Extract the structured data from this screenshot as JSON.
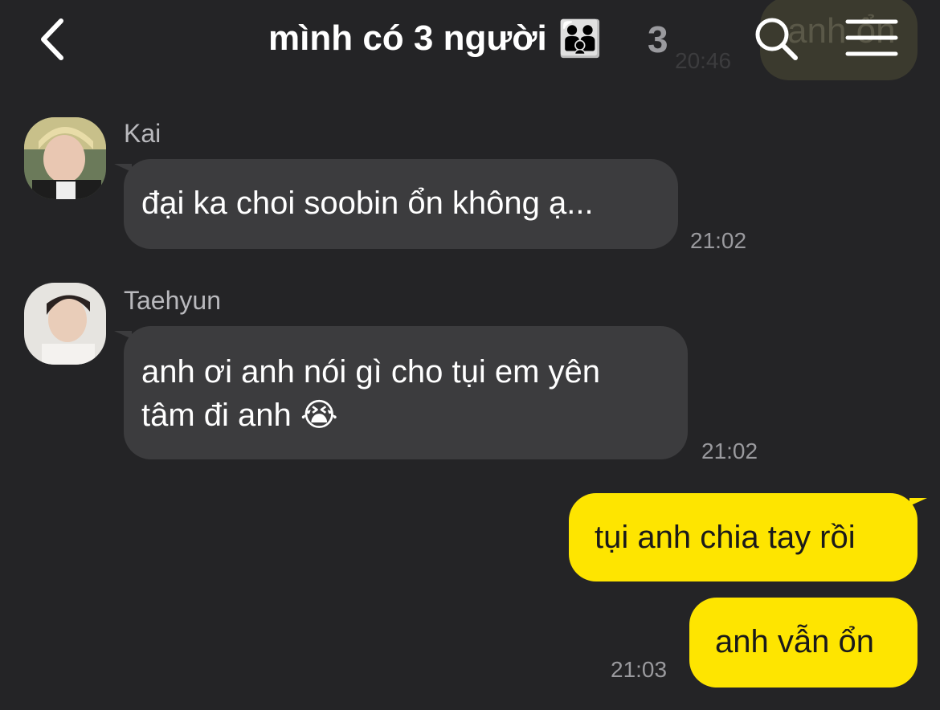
{
  "header": {
    "title": "mình có 3 người",
    "title_emoji": "👨‍👨‍👦",
    "member_count": "3"
  },
  "previous_message": {
    "text": "anh ổn",
    "time": "20:46"
  },
  "messages": [
    {
      "sender": "Kai",
      "text": "đại ka choi soobin ổn không ạ...",
      "time": "21:02",
      "direction": "incoming"
    },
    {
      "sender": "Taehyun",
      "text_line1": "anh ơi anh nói gì cho tụi em yên",
      "text_line2": "tâm đi anh 😭",
      "time": "21:02",
      "direction": "incoming"
    },
    {
      "text": "tụi anh chia tay rồi",
      "direction": "outgoing"
    },
    {
      "text": "anh vẫn ổn",
      "time": "21:03",
      "direction": "outgoing"
    }
  ],
  "colors": {
    "background": "#242426",
    "incoming_bubble": "#3c3c3e",
    "outgoing_bubble": "#fee500",
    "timestamp": "#9a9a9e"
  },
  "icons": {
    "back": "chevron-left-icon",
    "search": "search-icon",
    "menu": "hamburger-menu-icon"
  }
}
